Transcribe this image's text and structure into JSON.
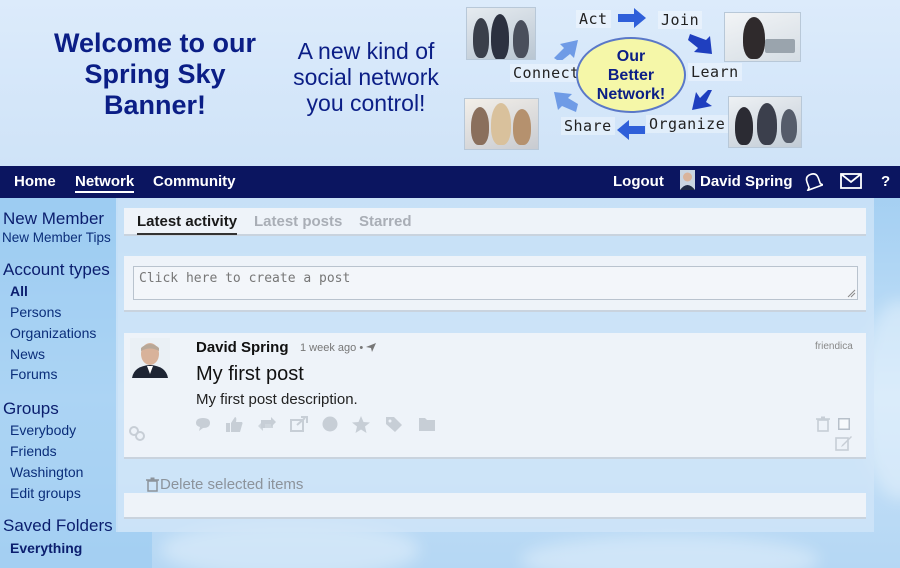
{
  "banner": {
    "title": "Welcome to our Spring Sky Banner!",
    "tagline": "A new kind of social network you control!",
    "diagram": {
      "center_lines": [
        "Our",
        "Better",
        "Network!"
      ],
      "words": {
        "act": "Act",
        "join": "Join",
        "connect": "Connect",
        "learn": "Learn",
        "share": "Share",
        "organize": "Organize"
      }
    }
  },
  "nav": {
    "home": "Home",
    "network": "Network",
    "community": "Community",
    "logout": "Logout",
    "user_name": "David Spring",
    "help": "?"
  },
  "sidebar": {
    "new_member": {
      "heading": "New Member",
      "link": "New Member Tips"
    },
    "account_types": {
      "heading": "Account types",
      "items": [
        "All",
        "Persons",
        "Organizations",
        "News",
        "Forums"
      ],
      "selected": "All"
    },
    "groups": {
      "heading": "Groups",
      "items": [
        "Everybody",
        "Friends",
        "Washington",
        "Edit groups"
      ]
    },
    "saved_folders": {
      "heading": "Saved Folders",
      "items": [
        "Everything"
      ]
    }
  },
  "tabs": [
    {
      "label": "Latest activity",
      "active": true
    },
    {
      "label": "Latest posts",
      "active": false
    },
    {
      "label": "Starred",
      "active": false
    }
  ],
  "composer": {
    "placeholder": "Click here to create a post"
  },
  "post": {
    "author": "David Spring",
    "time": "1 week ago",
    "separator": "•",
    "network": "friendica",
    "title": "My first post",
    "body": "My first post description."
  },
  "actions": {
    "delete_selected": "Delete selected items"
  },
  "colors": {
    "nav_bg": "#0b1560",
    "banner_text": "#0b1e86",
    "accent_yellow": "#f5f7a8"
  }
}
